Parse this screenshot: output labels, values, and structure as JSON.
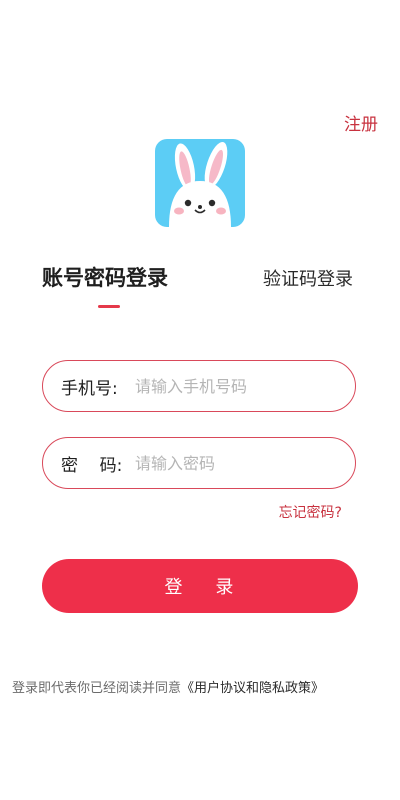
{
  "header": {
    "register_label": "注册"
  },
  "logo": {
    "icon": "rabbit-icon",
    "bg_color": "#5ccdf5"
  },
  "tabs": [
    {
      "label": "账号密码登录",
      "active": true
    },
    {
      "label": "验证码登录",
      "active": false
    }
  ],
  "form": {
    "phone": {
      "label": "手机号:",
      "placeholder": "请输入手机号码",
      "value": ""
    },
    "password": {
      "label": "密    码:",
      "placeholder": "请输入密码",
      "value": ""
    },
    "forgot_label": "忘记密码?"
  },
  "login_button_label": "登    录",
  "agreement": {
    "prefix": "登录即代表你已经阅读并同意",
    "link": "《用户协议和隐私政策》"
  },
  "colors": {
    "accent": "#ee2f4a",
    "link": "#c8323f",
    "field_border": "#d9495a"
  }
}
